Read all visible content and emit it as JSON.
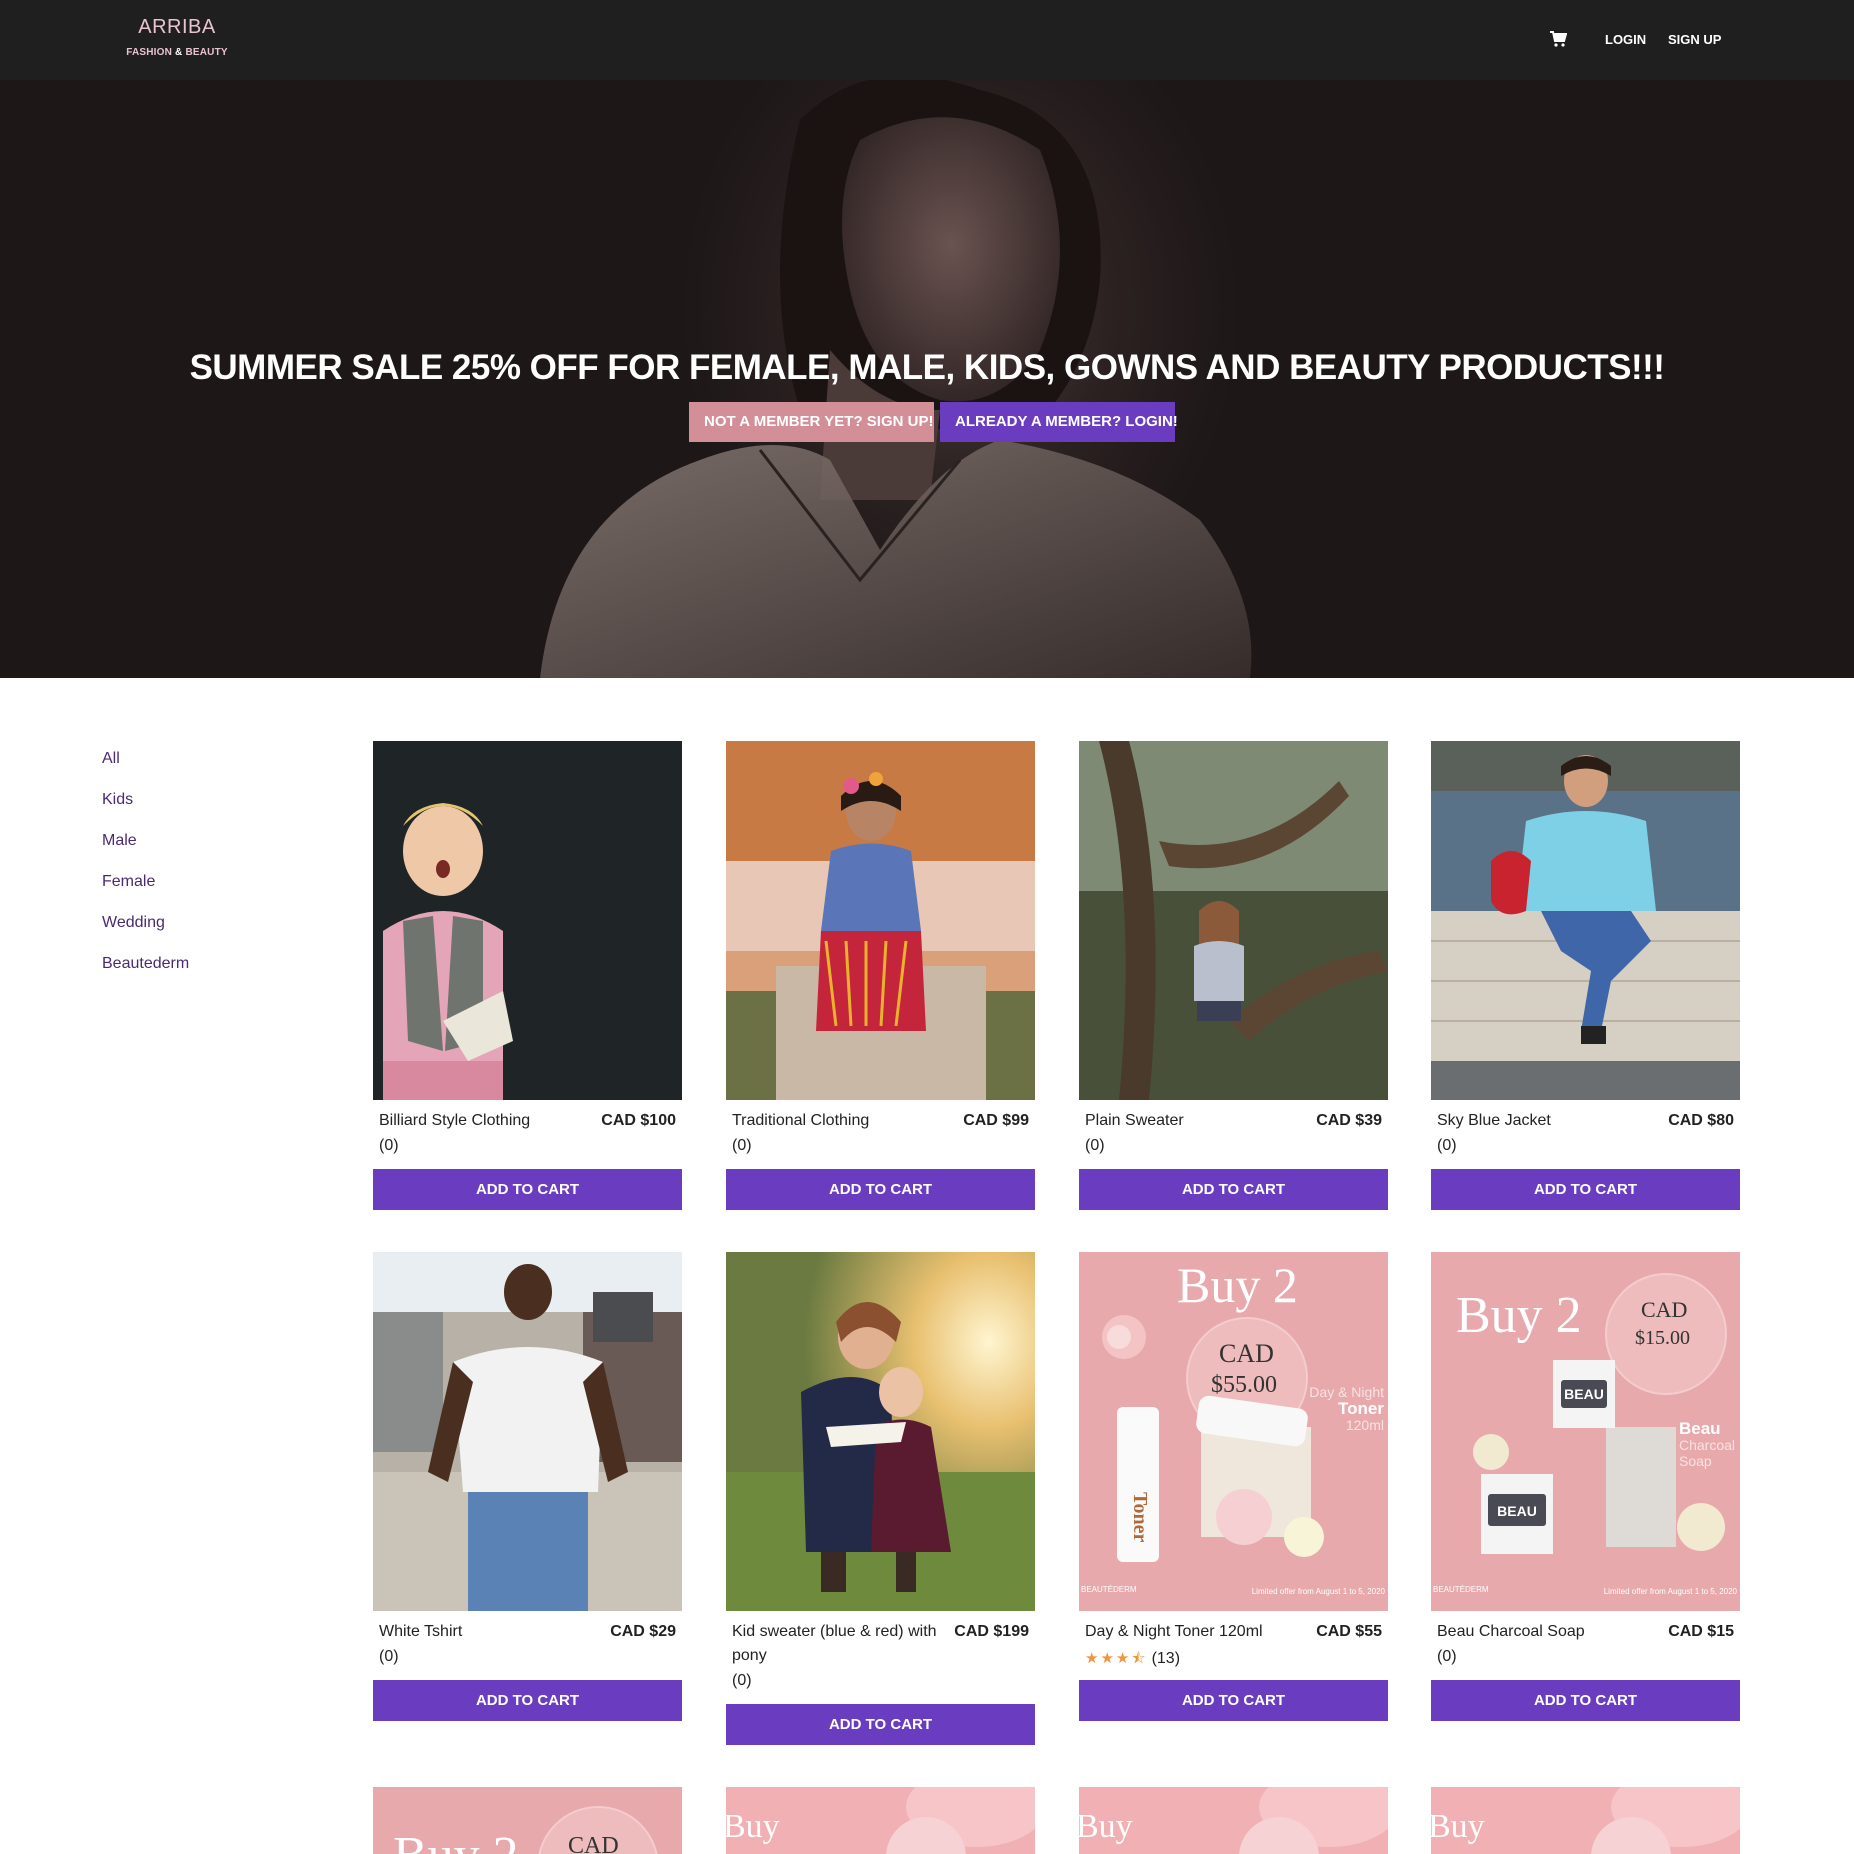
{
  "navbar": {
    "brand": "ARRIBA",
    "tagline_part1": "FASHION",
    "tagline_amp": "&",
    "tagline_part2": "BEAUTY",
    "cart_icon": "cart-icon",
    "login": "LOGIN",
    "signup": "SIGN UP"
  },
  "hero": {
    "title": "SUMMER SALE 25% OFF FOR FEMALE, MALE, KIDS, GOWNS AND BEAUTY PRODUCTS!!!",
    "signup_button": "NOT A MEMBER YET? SIGN UP!",
    "login_button": "ALREADY A MEMBER? LOGIN!"
  },
  "categories": [
    "All",
    "Kids",
    "Male",
    "Female",
    "Wedding",
    "Beautederm"
  ],
  "products": [
    {
      "name": "Billiard Style Clothing",
      "price": "CAD $100",
      "reviews": "(0)",
      "button": "ADD TO CART"
    },
    {
      "name": "Traditional Clothing",
      "price": "CAD $99",
      "reviews": "(0)",
      "button": "ADD TO CART"
    },
    {
      "name": "Plain Sweater",
      "price": "CAD $39",
      "reviews": "(0)",
      "button": "ADD TO CART"
    },
    {
      "name": "Sky Blue Jacket",
      "price": "CAD $80",
      "reviews": "(0)",
      "button": "ADD TO CART"
    },
    {
      "name": "White Tshirt",
      "price": "CAD $29",
      "reviews": "(0)",
      "button": "ADD TO CART"
    },
    {
      "name": "Kid sweater (blue & red) with pony",
      "price": "CAD $199",
      "reviews": "(0)",
      "button": "ADD TO CART"
    },
    {
      "name": "Day & Night Toner 120ml",
      "price": "CAD $55",
      "reviews": "(13)",
      "rating": 3.5,
      "button": "ADD TO CART"
    },
    {
      "name": "Beau Charcoal Soap",
      "price": "CAD $15",
      "reviews": "(0)",
      "button": "ADD TO CART"
    }
  ],
  "promo_images": {
    "toner": {
      "buy": "Buy 2",
      "cad": "CAD",
      "price": "$55.00",
      "line1": "Day & Night",
      "line2": "Toner",
      "line3": "120ml",
      "brand": "BEAUTÉDERM",
      "footer": "Limited offer from August 1 to 5, 2020"
    },
    "soap": {
      "buy": "Buy 2",
      "cad": "CAD",
      "price": "$15.00",
      "line1": "Beau",
      "line2": "Charcoal",
      "line3": "Soap",
      "box_label": "BEAU",
      "brand": "BEAUTÉDERM",
      "footer": "Limited offer from August 1 to 5, 2020"
    },
    "row3": [
      "Buy 2",
      "Buy",
      "Buy",
      "Buy"
    ],
    "row3_cad": "CAD"
  }
}
